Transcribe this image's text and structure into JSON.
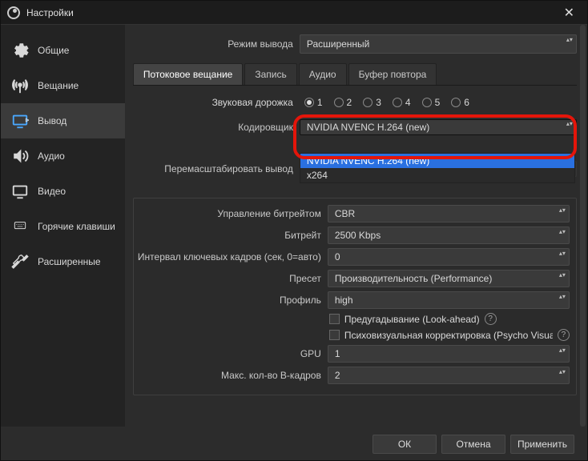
{
  "titlebar": {
    "title": "Настройки"
  },
  "sidebar": {
    "items": [
      {
        "label": "Общие"
      },
      {
        "label": "Вещание"
      },
      {
        "label": "Вывод"
      },
      {
        "label": "Аудио"
      },
      {
        "label": "Видео"
      },
      {
        "label": "Горячие клавиши"
      },
      {
        "label": "Расширенные"
      }
    ]
  },
  "output_mode": {
    "label": "Режим вывода",
    "value": "Расширенный"
  },
  "tabs": [
    "Потоковое вещание",
    "Запись",
    "Аудио",
    "Буфер повтора"
  ],
  "audio_track": {
    "label": "Звуковая дорожка",
    "options": [
      "1",
      "2",
      "3",
      "4",
      "5",
      "6"
    ],
    "selected": "1"
  },
  "encoder": {
    "label": "Кодировщик",
    "value": "NVIDIA NVENC H.264 (new)",
    "options": [
      "NVIDIA NVENC H.264 (new)",
      "x264"
    ]
  },
  "rescale": {
    "label": "Перемасштабировать вывод",
    "checked": false
  },
  "panel": {
    "rate_control": {
      "label": "Управление битрейтом",
      "value": "CBR"
    },
    "bitrate": {
      "label": "Битрейт",
      "value": "2500 Kbps"
    },
    "keyint": {
      "label": "Интервал ключевых кадров (сек, 0=авто)",
      "value": "0"
    },
    "preset": {
      "label": "Пресет",
      "value": "Производительность (Performance)"
    },
    "profile": {
      "label": "Профиль",
      "value": "high"
    },
    "lookahead": {
      "label": "Предугадывание (Look-ahead)",
      "checked": false
    },
    "psycho": {
      "label": "Психовизуальная корректировка (Psycho Visual Tuning)",
      "checked": false
    },
    "gpu": {
      "label": "GPU",
      "value": "1"
    },
    "bframes": {
      "label": "Макс. кол-во B-кадров",
      "value": "2"
    }
  },
  "footer": {
    "ok": "ОК",
    "cancel": "Отмена",
    "apply": "Применить"
  }
}
